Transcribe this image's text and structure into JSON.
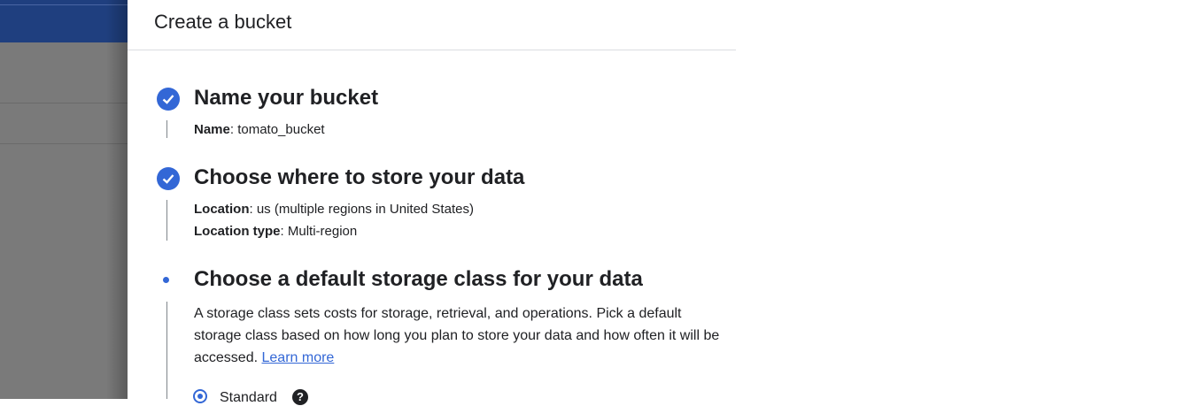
{
  "panel": {
    "title": "Create a bucket"
  },
  "steps": [
    {
      "title": "Name your bucket",
      "status": "complete",
      "summary": [
        {
          "label": "Name",
          "value": ": tomato_bucket"
        }
      ]
    },
    {
      "title": "Choose where to store your data",
      "status": "complete",
      "summary": [
        {
          "label": "Location",
          "value": ": us (multiple regions in United States)"
        },
        {
          "label": "Location type",
          "value": ": Multi-region"
        }
      ]
    },
    {
      "title": "Choose a default storage class for your data",
      "status": "active",
      "description": "A storage class sets costs for storage, retrieval, and operations. Pick a default storage class based on how long you plan to store your data and how often it will be accessed.",
      "link_label": "Learn more",
      "options": [
        {
          "label": "Standard",
          "selected": true
        }
      ]
    }
  ],
  "colors": {
    "accent": "#3367d6",
    "backdrop": "#7a7a7a",
    "topbar": "#1f3f7f"
  },
  "icons": {
    "complete": "check-circle-icon",
    "active": "dot-icon",
    "help": "help-icon"
  }
}
